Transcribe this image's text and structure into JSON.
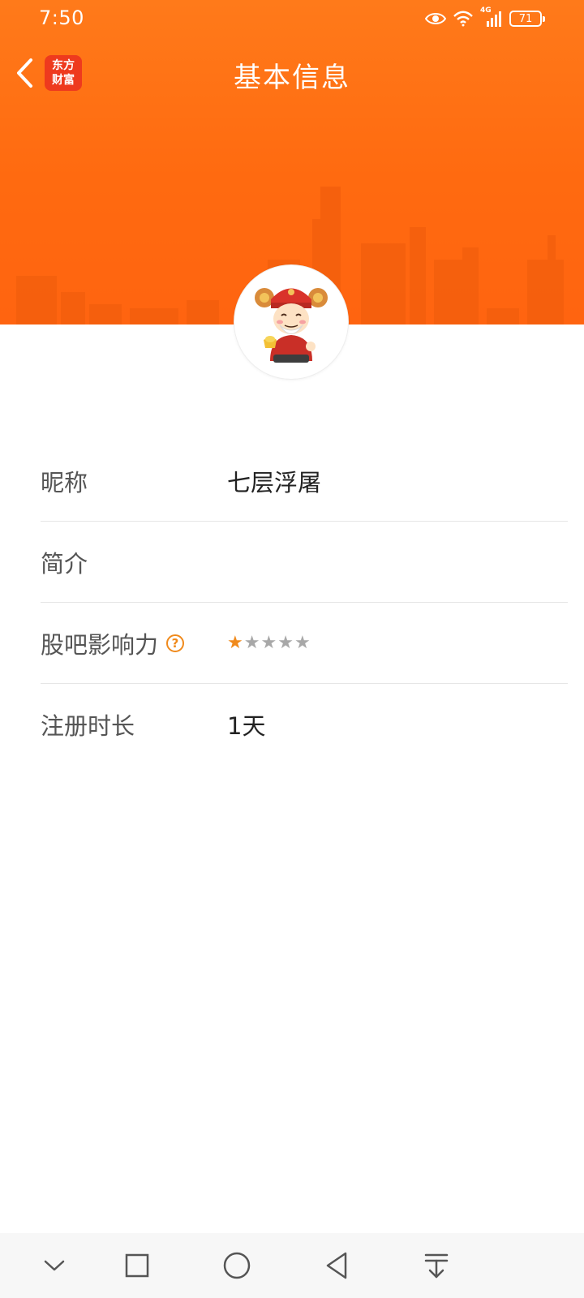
{
  "status_bar": {
    "time": "7:50",
    "network_label": "4G",
    "battery_level": "71",
    "icons": [
      "eye-icon",
      "wifi-icon",
      "signal-icon",
      "battery-icon"
    ]
  },
  "header": {
    "title": "基本信息",
    "logo_line1": "东方",
    "logo_line2": "财富",
    "back_icon": "chevron-left-icon",
    "background_color": "#ff6a10"
  },
  "profile": {
    "avatar_icon": "god-of-wealth-avatar"
  },
  "info": {
    "rows": [
      {
        "label": "昵称",
        "value": "七层浮屠"
      },
      {
        "label": "简介",
        "value": ""
      },
      {
        "label": "股吧影响力",
        "help_icon": "question-circle-icon",
        "stars_filled": 1,
        "stars_total": 5
      },
      {
        "label": "注册时长",
        "value": "1天"
      }
    ],
    "star_filled": "★",
    "star_empty_1": "★",
    "star_empty_2": "★",
    "star_empty_3": "★",
    "star_empty_4": "★",
    "help_glyph": "?",
    "accent_color": "#f08a1c"
  },
  "nav_bar": {
    "buttons": [
      "chevron-down-icon",
      "square-icon",
      "circle-icon",
      "triangle-back-icon",
      "download-icon"
    ]
  }
}
